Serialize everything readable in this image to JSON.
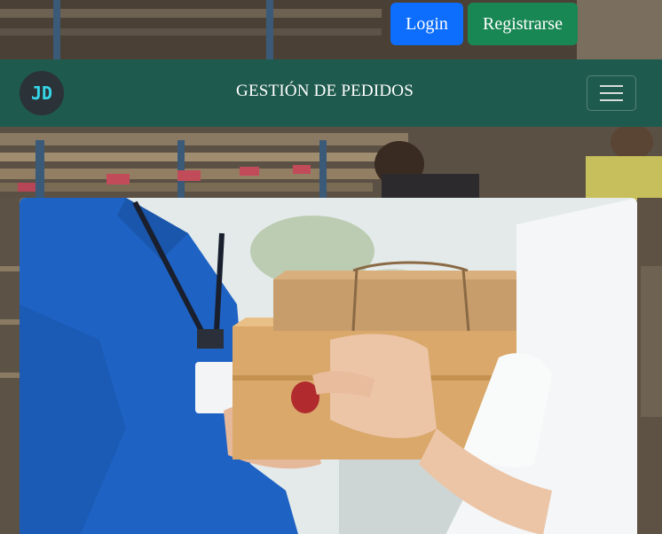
{
  "auth": {
    "login_label": "Login",
    "register_label": "Registrarse"
  },
  "navbar": {
    "logo_text": "JD",
    "title": "GESTIÓN DE PEDIDOS",
    "menu_icon": "hamburger-menu-icon"
  },
  "hero": {
    "image_subject": "delivery-handoff-photo"
  },
  "colors": {
    "login": "#0d6efd",
    "register": "#198754",
    "navbar": "#1f5a4e",
    "logo_accent": "#35d6e8"
  }
}
